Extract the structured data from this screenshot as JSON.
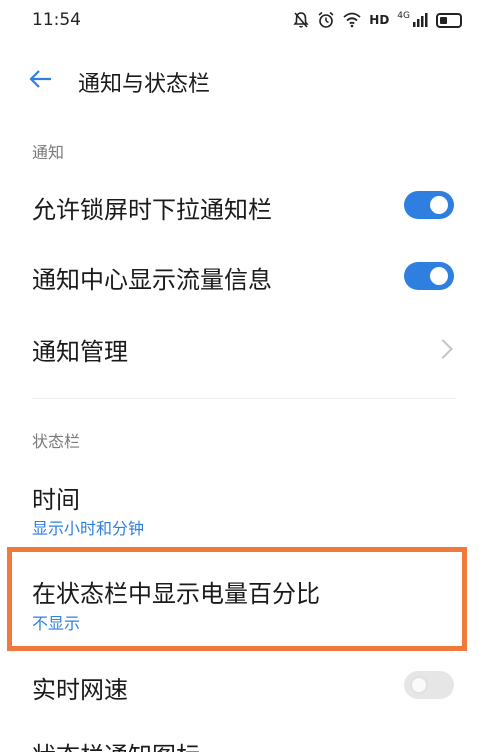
{
  "status_bar": {
    "time": "11:54",
    "hd_label": "HD",
    "network_label": "4G"
  },
  "header": {
    "title": "通知与状态栏"
  },
  "sections": {
    "notifications": {
      "label": "通知",
      "items": [
        {
          "label": "允许锁屏时下拉通知栏",
          "toggle": "on"
        },
        {
          "label": "通知中心显示流量信息",
          "toggle": "on"
        },
        {
          "label": "通知管理"
        }
      ]
    },
    "status_bar": {
      "label": "状态栏",
      "items": [
        {
          "label": "时间",
          "value": "显示小时和分钟"
        },
        {
          "label": "在状态栏中显示电量百分比",
          "value": "不显示"
        },
        {
          "label": "实时网速",
          "toggle": "off"
        },
        {
          "label": "状态栏通知图标"
        }
      ]
    }
  },
  "colors": {
    "accent": "#2f7fe0",
    "highlight": "#ef7a3c",
    "toggle_off": "#e6e6e6"
  }
}
